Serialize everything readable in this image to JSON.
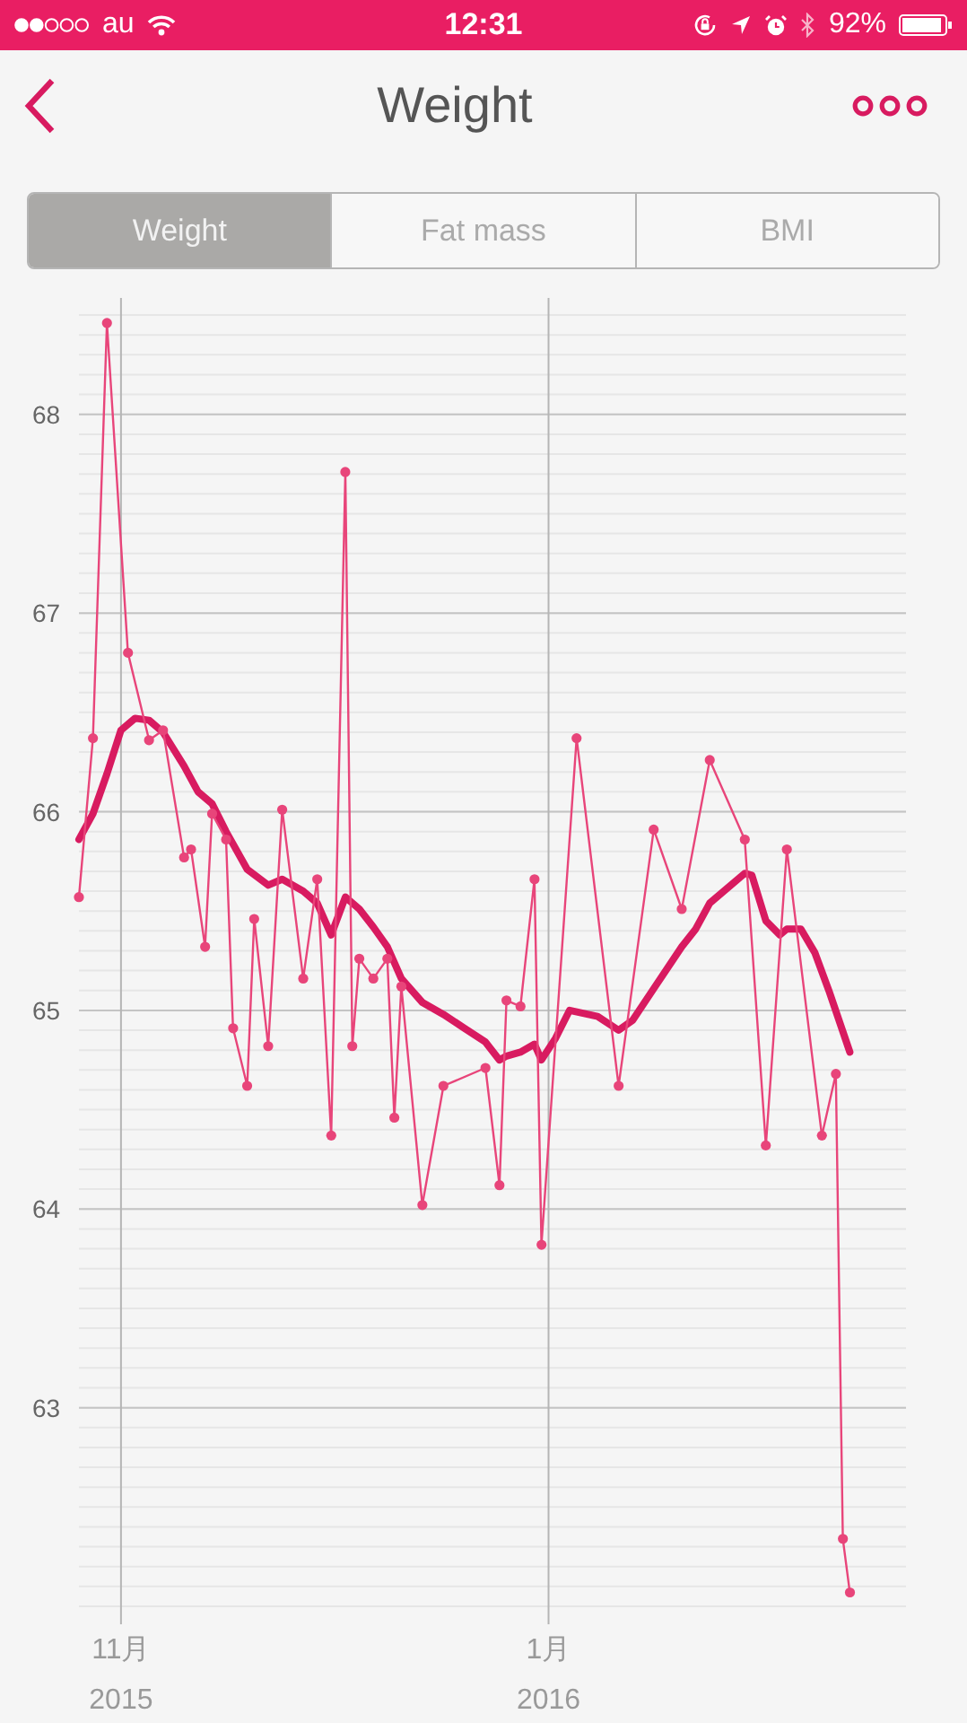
{
  "status_bar": {
    "carrier": "au",
    "time": "12:31",
    "battery": "92%"
  },
  "header": {
    "title": "Weight"
  },
  "tabs": [
    {
      "label": "Weight",
      "selected": true
    },
    {
      "label": "Fat mass",
      "selected": false
    },
    {
      "label": "BMI",
      "selected": false
    }
  ],
  "chart": {
    "chart_data": {
      "type": "line",
      "grid": true,
      "xlim": [
        "2015-10-26",
        "2016-02-21"
      ],
      "ylim": [
        62,
        68.55
      ],
      "xticks": [
        {
          "value": "2015-11-01",
          "label": "11月"
        },
        {
          "value": "2016-01-01",
          "label": "1月"
        }
      ],
      "yticks": [
        63,
        64,
        65,
        66,
        67,
        68
      ],
      "series": [
        {
          "color": "#e8457a",
          "marker": "circle",
          "x": [
            "2015-10-26",
            "2015-10-28",
            "2015-10-30",
            "2015-11-02",
            "2015-11-05",
            "2015-11-07",
            "2015-11-10",
            "2015-11-11",
            "2015-11-13",
            "2015-11-14",
            "2015-11-16",
            "2015-11-17",
            "2015-11-19",
            "2015-11-20",
            "2015-11-22",
            "2015-11-24",
            "2015-11-27",
            "2015-11-29",
            "2015-12-01",
            "2015-12-03",
            "2015-12-04",
            "2015-12-05",
            "2015-12-07",
            "2015-12-09",
            "2015-12-10",
            "2015-12-11",
            "2015-12-14",
            "2015-12-17",
            "2015-12-23",
            "2015-12-25",
            "2015-12-26",
            "2015-12-28",
            "2015-12-30",
            "2015-12-31",
            "2016-01-05",
            "2016-01-11",
            "2016-01-16",
            "2016-01-20",
            "2016-01-24",
            "2016-01-29",
            "2016-02-01",
            "2016-02-04",
            "2016-02-09",
            "2016-02-11",
            "2016-02-12",
            "2016-02-13"
          ],
          "values": [
            65.57,
            66.37,
            68.46,
            66.8,
            66.36,
            66.41,
            65.77,
            65.81,
            65.32,
            65.99,
            65.86,
            64.91,
            64.62,
            65.46,
            64.82,
            66.01,
            65.16,
            65.66,
            64.37,
            67.71,
            64.82,
            65.26,
            65.16,
            65.26,
            64.46,
            65.12,
            64.02,
            64.62,
            64.71,
            64.12,
            65.05,
            65.02,
            65.66,
            63.82,
            66.37,
            64.62,
            65.91,
            65.51,
            66.26,
            65.86,
            64.32,
            65.81,
            64.37,
            64.68,
            62.34,
            62.07
          ]
        },
        {
          "color": "#d81b60",
          "x": [
            "2015-10-26",
            "2015-10-28",
            "2015-10-30",
            "2015-11-01",
            "2015-11-03",
            "2015-11-05",
            "2015-11-07",
            "2015-11-10",
            "2015-11-12",
            "2015-11-14",
            "2015-11-16",
            "2015-11-19",
            "2015-11-22",
            "2015-11-24",
            "2015-11-27",
            "2015-11-29",
            "2015-12-01",
            "2015-12-03",
            "2015-12-05",
            "2015-12-07",
            "2015-12-09",
            "2015-12-11",
            "2015-12-14",
            "2015-12-17",
            "2015-12-20",
            "2015-12-23",
            "2015-12-25",
            "2015-12-26",
            "2015-12-28",
            "2015-12-30",
            "2015-12-31",
            "2016-01-02",
            "2016-01-04",
            "2016-01-08",
            "2016-01-11",
            "2016-01-13",
            "2016-01-16",
            "2016-01-20",
            "2016-01-22",
            "2016-01-24",
            "2016-01-29",
            "2016-01-30",
            "2016-02-01",
            "2016-02-03",
            "2016-02-04",
            "2016-02-06",
            "2016-02-08",
            "2016-02-10",
            "2016-02-13"
          ],
          "values": [
            65.86,
            65.99,
            66.19,
            66.41,
            66.47,
            66.46,
            66.4,
            66.23,
            66.1,
            66.04,
            65.9,
            65.71,
            65.63,
            65.66,
            65.6,
            65.54,
            65.38,
            65.57,
            65.51,
            65.42,
            65.32,
            65.16,
            65.04,
            64.98,
            64.91,
            64.84,
            64.75,
            64.77,
            64.79,
            64.83,
            64.75,
            64.86,
            65.0,
            64.97,
            64.9,
            64.95,
            65.11,
            65.32,
            65.41,
            65.54,
            65.69,
            65.68,
            65.45,
            65.38,
            65.41,
            65.41,
            65.29,
            65.1,
            64.79
          ]
        }
      ]
    },
    "year_labels": [
      "2015",
      "2016"
    ]
  }
}
